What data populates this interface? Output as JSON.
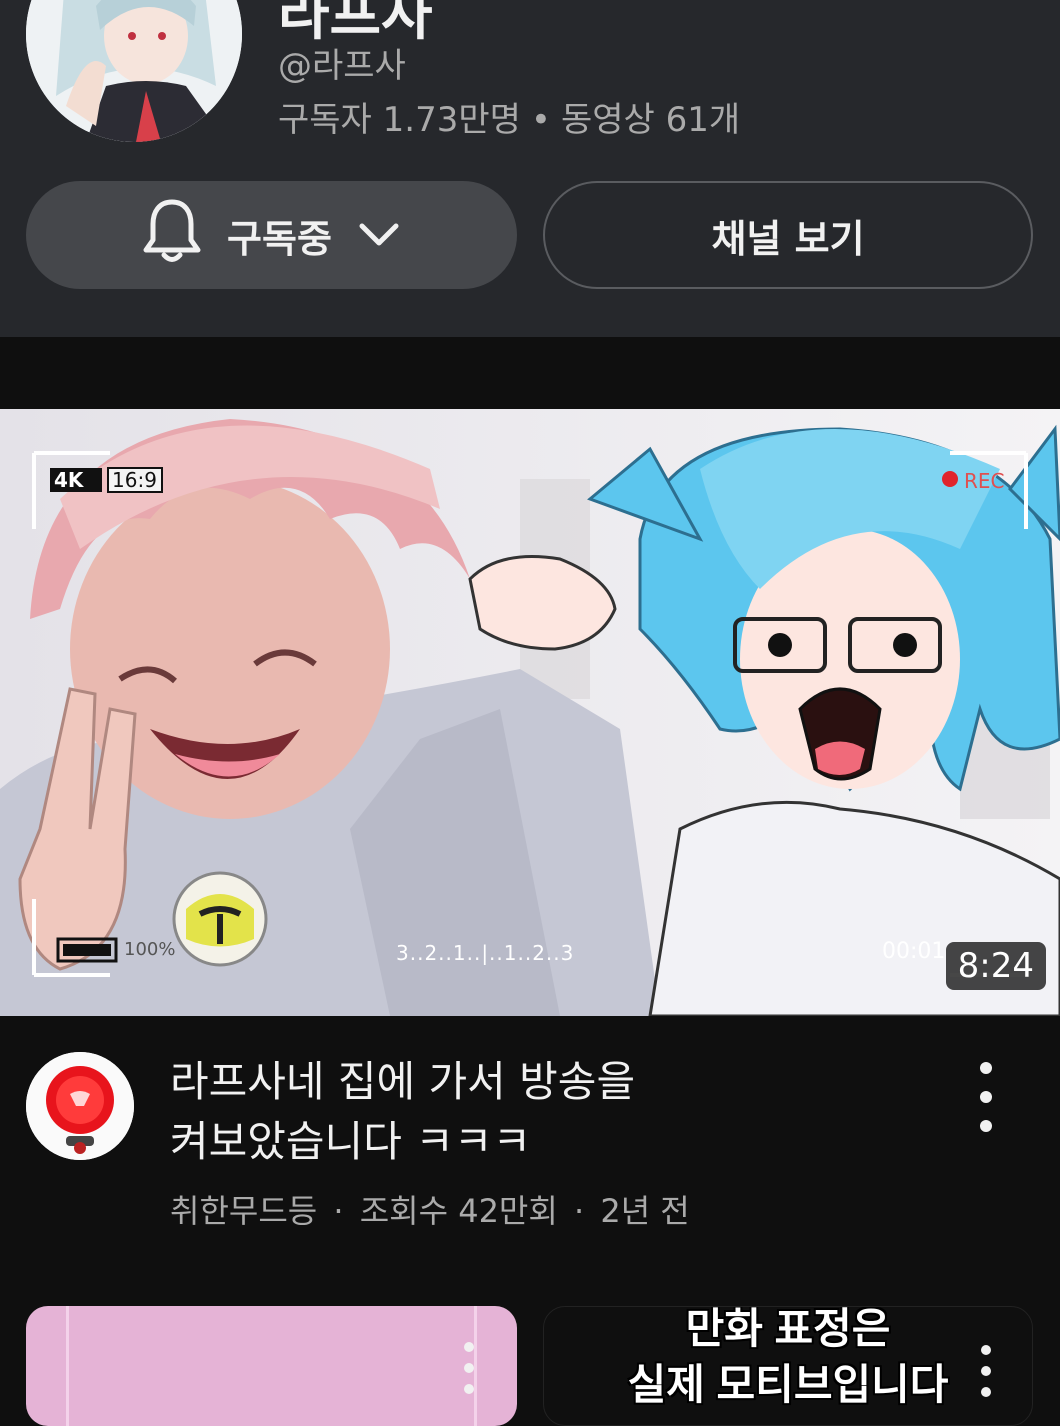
{
  "channel": {
    "name": "라프사",
    "handle": "@라프사",
    "subscribers": "구독자 1.73만명",
    "separator": "•",
    "video_count": "동영상 61개",
    "subscribed_label": "구독중",
    "view_channel_label": "채널 보기"
  },
  "video": {
    "duration": "8:24",
    "title_line1": "라프사네 집에 가서 방송을",
    "title_line2": "켜보았습니다 ㅋㅋㅋ",
    "channel": "취한무드등",
    "views": "조회수 42만회",
    "age": "2년 전",
    "meta_sep": "·",
    "overlay": {
      "format": "4K",
      "ratio": "16:9",
      "battery": "100%",
      "rec": "REC",
      "timer": "00:01",
      "countdown": "3..2..1..|..1..2..3"
    }
  },
  "shorts": [
    {
      "title_line1": "",
      "title_line2": ""
    },
    {
      "title_line1": "만화 표정은",
      "title_line2": "실제 모티브입니다"
    }
  ],
  "colors": {
    "header_bg": "#26282c",
    "page_bg": "#0f0f0f",
    "button_bg": "#45474b",
    "secondary_text": "#aaaaaa",
    "pink_hair": "#e8a0a8",
    "blue_hair": "#5cc6ee"
  },
  "icons": [
    "bell-icon",
    "chevron-down-icon",
    "more-vert-icon"
  ]
}
